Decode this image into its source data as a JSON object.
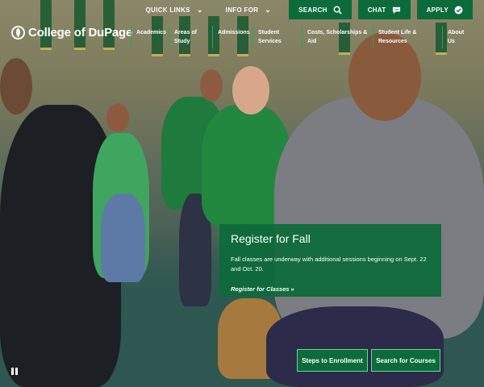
{
  "brand": {
    "name": "College of DuPage"
  },
  "utility": {
    "quick_links": "QUICK LINKS",
    "info_for": "INFO FOR",
    "search": "SEARCH",
    "chat": "CHAT",
    "apply": "APPLY"
  },
  "nav": {
    "items": [
      {
        "line1": "Academics",
        "line2": ""
      },
      {
        "line1": "Areas of",
        "line2": "Study"
      },
      {
        "line1": "Admissions",
        "line2": ""
      },
      {
        "line1": "Student",
        "line2": "Services"
      },
      {
        "line1": "Costs, Scholarships &",
        "line2": "Aid"
      },
      {
        "line1": "Student Life &",
        "line2": "Resources"
      },
      {
        "line1": "About",
        "line2": "Us"
      }
    ]
  },
  "hero": {
    "card": {
      "title": "Register for Fall",
      "body": "Fall classes are underway with additional sessions beginning on Sept. 22 and Oct. 20.",
      "link": "Register for Classes"
    },
    "cta": {
      "steps": "Steps to Enrollment",
      "search": "Search for Courses"
    }
  },
  "icons": {
    "logo": "cod-logo-icon",
    "quick_links_chevron": "chevron-down-icon",
    "info_for_chevron": "chevron-down-icon",
    "search": "search-icon",
    "chat": "chat-bubble-icon",
    "apply": "check-circle-icon",
    "pause": "pause-icon"
  },
  "colors": {
    "brand_green": "#0c6b3a",
    "nav_divider": "#2ca55b",
    "cta_border": "#6ed39a"
  }
}
